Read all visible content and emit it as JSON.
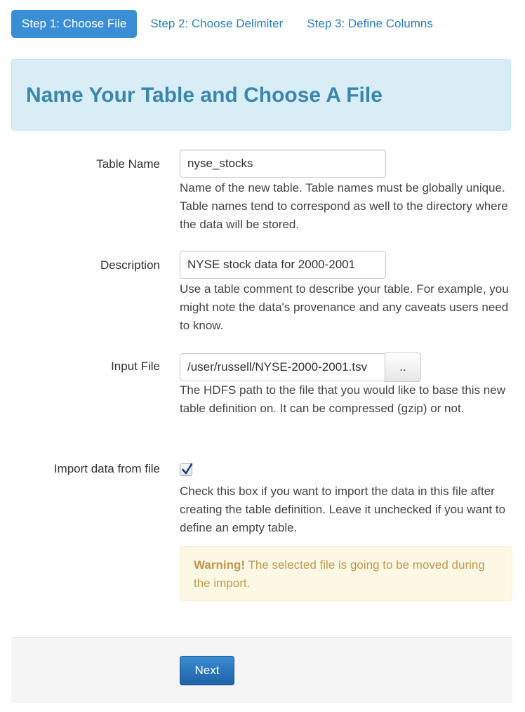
{
  "steps": [
    {
      "label": "Step 1: Choose File",
      "active": true
    },
    {
      "label": "Step 2: Choose Delimiter",
      "active": false
    },
    {
      "label": "Step 3: Define Columns",
      "active": false
    }
  ],
  "header": {
    "title": "Name Your Table and Choose A File"
  },
  "form": {
    "table_name": {
      "label": "Table Name",
      "value": "nyse_stocks",
      "help": "Name of the new table. Table names must be globally unique. Table names tend to correspond as well to the directory where the data will be stored."
    },
    "description": {
      "label": "Description",
      "value": "NYSE stock data for 2000-2001",
      "help": "Use a table comment to describe your table. For example, you might note the data's provenance and any caveats users need to know."
    },
    "input_file": {
      "label": "Input File",
      "value": "/user/russell/NYSE-2000-2001.tsv",
      "browse_label": "..",
      "help": "The HDFS path to the file that you would like to base this new table definition on. It can be compressed (gzip) or not."
    },
    "import_data": {
      "label": "Import data from file",
      "checked": true,
      "help": "Check this box if you want to import the data in this file after creating the table definition. Leave it unchecked if you want to define an empty table."
    },
    "warning": {
      "strong": "Warning!",
      "text": " The selected file is going to be moved during the import."
    }
  },
  "actions": {
    "next_label": "Next"
  },
  "colors": {
    "accent": "#3a8ed6",
    "link": "#2a7fc0",
    "heading": "#3a87ad",
    "info_bg": "#d9edf7",
    "warning_bg": "#fcf8e3",
    "warning_text": "#c09853"
  }
}
